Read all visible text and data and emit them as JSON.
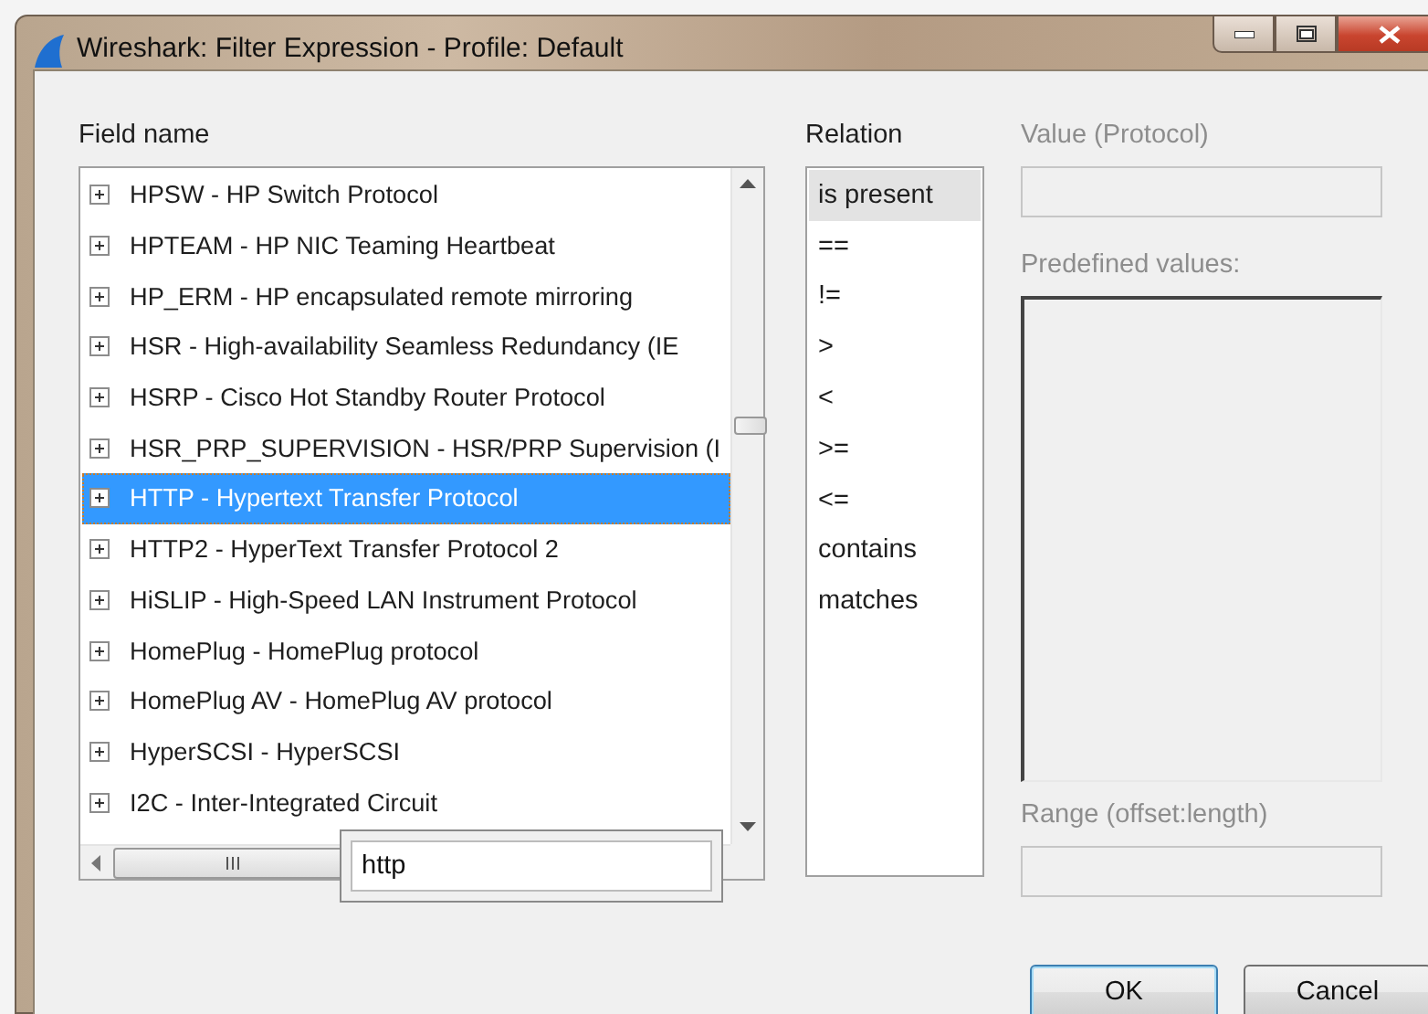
{
  "window": {
    "title": "Wireshark: Filter Expression - Profile: Default"
  },
  "field_name": {
    "label": "Field name",
    "items": [
      {
        "label": "HPSW - HP Switch Protocol",
        "selected": false,
        "expanded": false
      },
      {
        "label": "HPTEAM - HP NIC Teaming Heartbeat",
        "selected": false,
        "expanded": false
      },
      {
        "label": "HP_ERM - HP encapsulated remote mirroring",
        "selected": false,
        "expanded": false
      },
      {
        "label": "HSR - High-availability Seamless Redundancy (IE",
        "selected": false,
        "expanded": false
      },
      {
        "label": "HSRP - Cisco Hot Standby Router Protocol",
        "selected": false,
        "expanded": false
      },
      {
        "label": "HSR_PRP_SUPERVISION - HSR/PRP Supervision (I",
        "selected": false,
        "expanded": false
      },
      {
        "label": "HTTP - Hypertext Transfer Protocol",
        "selected": true,
        "expanded": false
      },
      {
        "label": "HTTP2 - HyperText Transfer Protocol 2",
        "selected": false,
        "expanded": false
      },
      {
        "label": "HiSLIP - High-Speed LAN Instrument Protocol",
        "selected": false,
        "expanded": false
      },
      {
        "label": "HomePlug - HomePlug protocol",
        "selected": false,
        "expanded": false
      },
      {
        "label": "HomePlug AV - HomePlug AV protocol",
        "selected": false,
        "expanded": false
      },
      {
        "label": "HyperSCSI - HyperSCSI",
        "selected": false,
        "expanded": false
      },
      {
        "label": "I2C - Inter-Integrated Circuit",
        "selected": false,
        "expanded": false
      }
    ],
    "search": {
      "value": "http"
    }
  },
  "relation": {
    "label": "Relation",
    "items": [
      {
        "label": "is present",
        "selected": true
      },
      {
        "label": "==",
        "selected": false
      },
      {
        "label": "!=",
        "selected": false
      },
      {
        "label": ">",
        "selected": false
      },
      {
        "label": "<",
        "selected": false
      },
      {
        "label": ">=",
        "selected": false
      },
      {
        "label": "<=",
        "selected": false
      },
      {
        "label": "contains",
        "selected": false
      },
      {
        "label": "matches",
        "selected": false
      }
    ]
  },
  "value": {
    "label": "Value (Protocol)",
    "disabled": true
  },
  "predefined_values": {
    "label": "Predefined values:",
    "disabled": true
  },
  "range": {
    "label": "Range (offset:length)",
    "disabled": true
  },
  "buttons": [
    {
      "label": "OK",
      "default": true
    },
    {
      "label": "Cancel",
      "default": false
    }
  ]
}
